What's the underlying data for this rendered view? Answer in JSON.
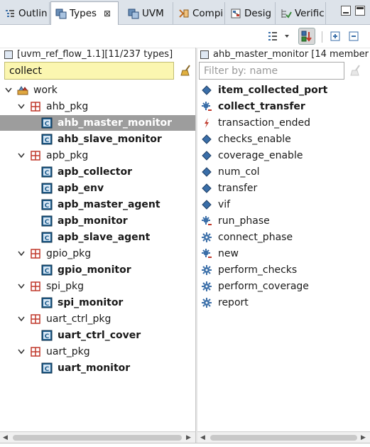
{
  "tabs": [
    {
      "label": "Outlin",
      "icon": "outline-icon"
    },
    {
      "label": "Types",
      "icon": "type-hierarchy-icon",
      "active": true
    },
    {
      "label": "UVM",
      "icon": "uvm-icon"
    },
    {
      "label": "Compi",
      "icon": "compile-icon"
    },
    {
      "label": "Desig",
      "icon": "design-icon"
    },
    {
      "label": "Verific",
      "icon": "verification-icon"
    }
  ],
  "tab_close": "⊠",
  "left_pane": {
    "header": "[uvm_ref_flow_1.1][11/237 types]",
    "filter_value": "collect",
    "tree": [
      {
        "label": "work",
        "level": 0,
        "kind": "library",
        "bold": false
      },
      {
        "label": "ahb_pkg",
        "level": 1,
        "kind": "package",
        "bold": false
      },
      {
        "label": "ahb_master_monitor",
        "level": 2,
        "kind": "class",
        "bold": true,
        "selected": true
      },
      {
        "label": "ahb_slave_monitor",
        "level": 2,
        "kind": "class",
        "bold": true
      },
      {
        "label": "apb_pkg",
        "level": 1,
        "kind": "package",
        "bold": false
      },
      {
        "label": "apb_collector",
        "level": 2,
        "kind": "class",
        "bold": true
      },
      {
        "label": "apb_env",
        "level": 2,
        "kind": "class",
        "bold": true
      },
      {
        "label": "apb_master_agent",
        "level": 2,
        "kind": "class",
        "bold": true
      },
      {
        "label": "apb_monitor",
        "level": 2,
        "kind": "class",
        "bold": true
      },
      {
        "label": "apb_slave_agent",
        "level": 2,
        "kind": "class",
        "bold": true
      },
      {
        "label": "gpio_pkg",
        "level": 1,
        "kind": "package",
        "bold": false
      },
      {
        "label": "gpio_monitor",
        "level": 2,
        "kind": "class",
        "bold": true
      },
      {
        "label": "spi_pkg",
        "level": 1,
        "kind": "package",
        "bold": false
      },
      {
        "label": "spi_monitor",
        "level": 2,
        "kind": "class",
        "bold": true
      },
      {
        "label": "uart_ctrl_pkg",
        "level": 1,
        "kind": "package",
        "bold": false
      },
      {
        "label": "uart_ctrl_cover",
        "level": 2,
        "kind": "class",
        "bold": true
      },
      {
        "label": "uart_pkg",
        "level": 1,
        "kind": "package",
        "bold": false
      },
      {
        "label": "uart_monitor",
        "level": 2,
        "kind": "class",
        "bold": true
      }
    ]
  },
  "right_pane": {
    "header": "ahb_master_monitor [14 member",
    "filter_placeholder": "Filter by: name",
    "members": [
      {
        "label": "item_collected_port",
        "kind": "field",
        "bold": true
      },
      {
        "label": "collect_transfer",
        "kind": "task",
        "bold": true
      },
      {
        "label": "transaction_ended",
        "kind": "event",
        "bold": false
      },
      {
        "label": "checks_enable",
        "kind": "field",
        "bold": false
      },
      {
        "label": "coverage_enable",
        "kind": "field",
        "bold": false
      },
      {
        "label": "num_col",
        "kind": "field",
        "bold": false
      },
      {
        "label": "transfer",
        "kind": "field",
        "bold": false
      },
      {
        "label": "vif",
        "kind": "field",
        "bold": false
      },
      {
        "label": "run_phase",
        "kind": "task",
        "bold": false
      },
      {
        "label": "connect_phase",
        "kind": "function",
        "bold": false
      },
      {
        "label": "new",
        "kind": "task",
        "bold": false
      },
      {
        "label": "perform_checks",
        "kind": "function",
        "bold": false
      },
      {
        "label": "perform_coverage",
        "kind": "function",
        "bold": false
      },
      {
        "label": "report",
        "kind": "function",
        "bold": false
      }
    ]
  },
  "colors": {
    "selection": "#9d9d9d",
    "filter_active_bg": "#fbf6b0",
    "package_icon": "#c0392b",
    "class_icon": "#1f5f8f",
    "member_icon": "#3a6ea8"
  }
}
